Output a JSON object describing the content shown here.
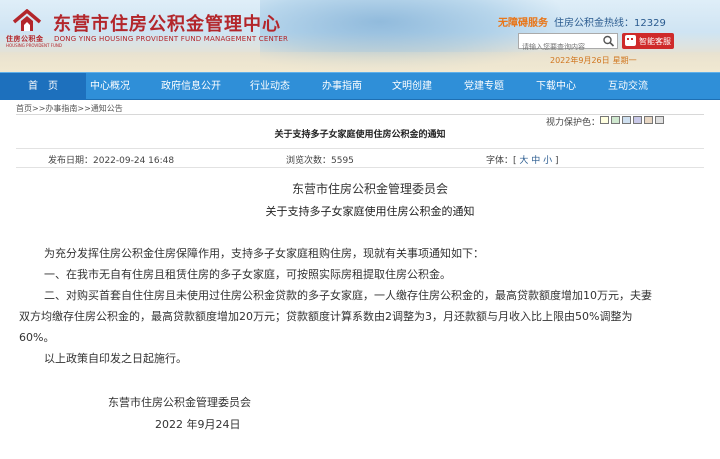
{
  "header": {
    "site_title": "东营市住房公积金管理中心",
    "site_title_en": "DONG YING HOUSING PROVIDENT FUND MANAGEMENT CENTER",
    "logo_text": "住房公积金",
    "logo_sub": "HOUSING PROVIDENT FUND",
    "accessibility_label": "无障碍服务",
    "hotline_text": "住房公积金热线：12329",
    "search_placeholder": "请输入您要查询内容",
    "robot_label": "智能客服",
    "date": "2022年9月26日",
    "weekday": "星期一",
    "brand_color": "#b3262b"
  },
  "nav": {
    "items": [
      {
        "label": "首　页"
      },
      {
        "label": "中心概况"
      },
      {
        "label": "政府信息公开"
      },
      {
        "label": "行业动态"
      },
      {
        "label": "办事指南"
      },
      {
        "label": "文明创建"
      },
      {
        "label": "党建专题"
      },
      {
        "label": "下载中心"
      },
      {
        "label": "互动交流"
      }
    ],
    "color": "#2f8fd8"
  },
  "breadcrumb": "首页>>办事指南>>通知公告",
  "protect_label": "视力保护色：",
  "protect_colors": [
    "#ffffe0",
    "#cfe8cf",
    "#cfe0f0",
    "#c9c9e8",
    "#e8d7c4",
    "#e0e0e0"
  ],
  "article": {
    "title_small": "关于支持多子女家庭使用住房公积金的通知",
    "publish_time": "发布日期：2022-09-24 16:48",
    "views": "浏览次数：5595",
    "font_size_label": "字体：[",
    "font_size_options": "大 中 小",
    "font_size_end": "]",
    "org": "东营市住房公积金管理委员会",
    "notice_title": "关于支持多子女家庭使用住房公积金的通知",
    "paragraphs": [
      "为充分发挥住房公积金住房保障作用，支持多子女家庭租购住房，现就有关事项通知如下：",
      "一、在我市无自有住房且租赁住房的多子女家庭，可按照实际房租提取住房公积金。",
      "二、对购买首套自住住房且未使用过住房公积金贷款的多子女家庭，一人缴存住房公积金的，最高贷款额度增加10万元，夫妻",
      "双方均缴存住房公积金的，最高贷款额度增加20万元；贷款额度计算系数由2调整为3，月还款额与月收入比上限由50%调整为",
      "60%。",
      "以上政策自印发之日起施行。"
    ],
    "signature_org": "东营市住房公积金管理委员会",
    "signature_date": "2022 年9月24日"
  }
}
